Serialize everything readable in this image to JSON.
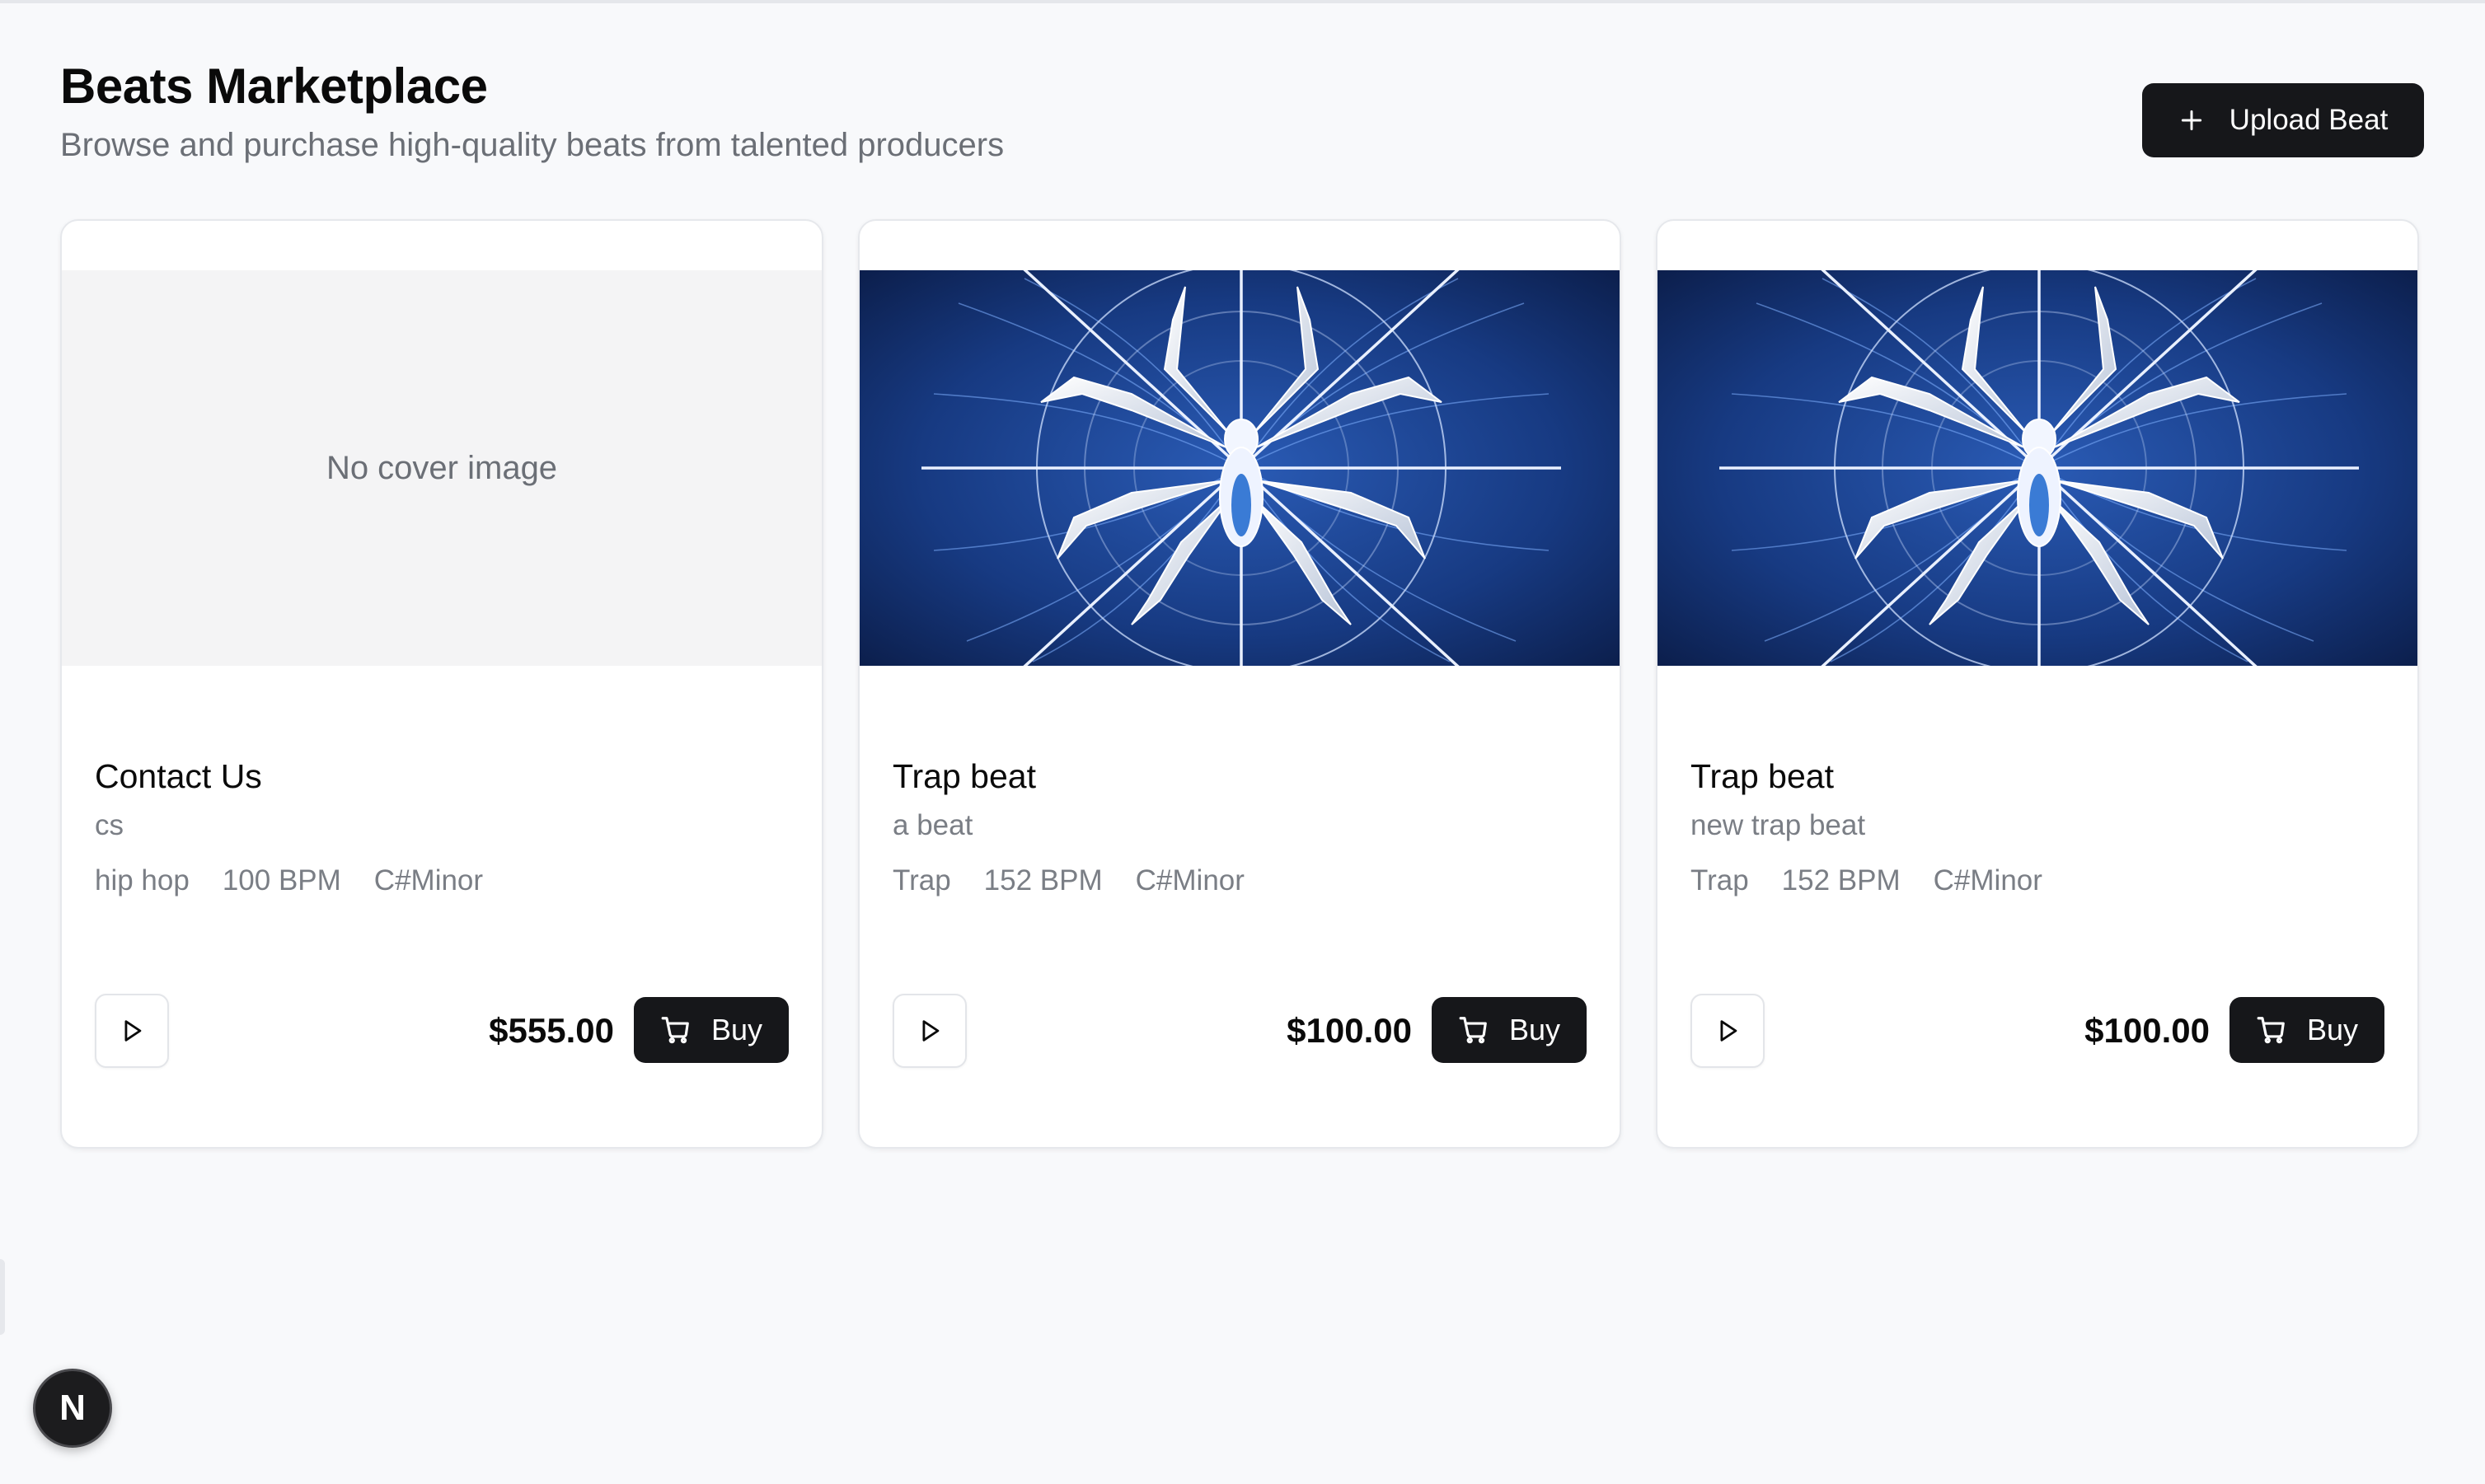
{
  "header": {
    "title": "Beats Marketplace",
    "subtitle": "Browse and purchase high-quality beats from talented producers",
    "upload_label": "Upload Beat",
    "upload_icon": "plus-icon"
  },
  "colors": {
    "page_background": "#f8f9fb",
    "primary_button": "#16171a",
    "cover_navy": "#1b3f86",
    "placeholder_bg": "#f4f4f5"
  },
  "beats": [
    {
      "cover": "No cover image",
      "title": "Contact Us",
      "description": "cs",
      "genre": "hip hop",
      "bpm": "100 BPM",
      "key": "C#Minor",
      "price": "$555.00",
      "buy_label": "Buy"
    },
    {
      "cover_icon": "spider-web-artwork",
      "title": "Trap beat",
      "description": "a beat",
      "genre": "Trap",
      "bpm": "152 BPM",
      "key": "C#Minor",
      "price": "$100.00",
      "buy_label": "Buy"
    },
    {
      "cover_icon": "spider-web-artwork",
      "title": "Trap beat",
      "description": "new trap beat",
      "genre": "Trap",
      "bpm": "152 BPM",
      "key": "C#Minor",
      "price": "$100.00",
      "buy_label": "Buy"
    }
  ],
  "dev_badge": {
    "letter": "N",
    "icon": "nextjs-logo-icon"
  }
}
